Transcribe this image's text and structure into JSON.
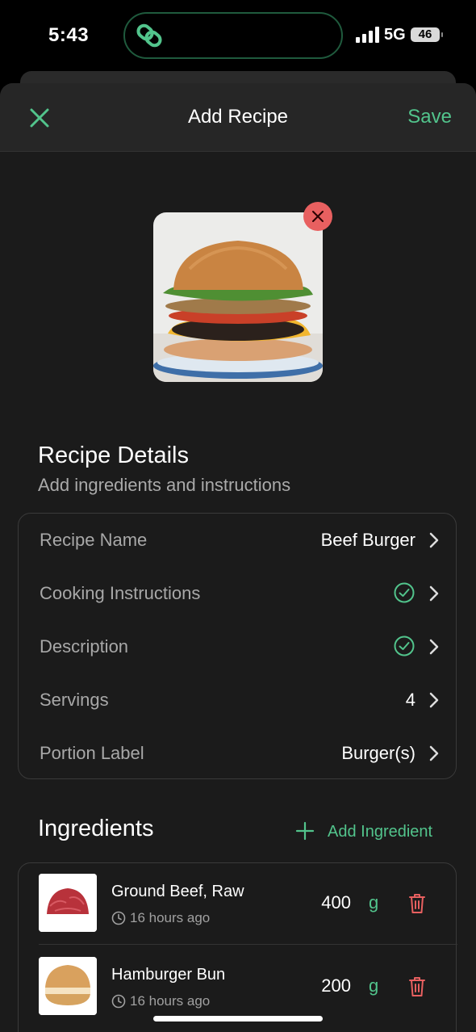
{
  "status_bar": {
    "time": "5:43",
    "network": "5G",
    "battery": "46"
  },
  "header": {
    "title": "Add Recipe",
    "save_label": "Save"
  },
  "details": {
    "title": "Recipe Details",
    "subtitle": "Add ingredients and instructions",
    "rows": [
      {
        "label": "Recipe Name",
        "value": "Beef Burger"
      },
      {
        "label": "Cooking Instructions",
        "value": ""
      },
      {
        "label": "Description",
        "value": ""
      },
      {
        "label": "Servings",
        "value": "4"
      },
      {
        "label": "Portion Label",
        "value": "Burger(s)"
      }
    ]
  },
  "ingredients": {
    "title": "Ingredients",
    "add_label": "Add Ingredient",
    "items": [
      {
        "name": "Ground Beef, Raw",
        "time": "16 hours ago",
        "quantity": "400",
        "unit": "g"
      },
      {
        "name": "Hamburger Bun",
        "time": "16 hours ago",
        "quantity": "200",
        "unit": "g"
      }
    ]
  },
  "colors": {
    "accent": "#52c48c",
    "danger": "#e86060",
    "background": "#1b1b1b"
  }
}
